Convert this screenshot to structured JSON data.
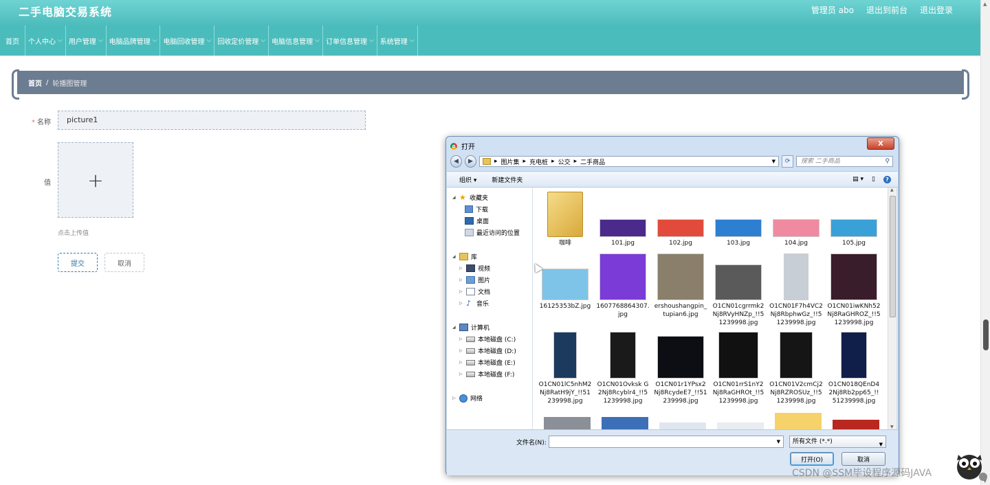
{
  "app": {
    "brand": "二手电脑交易系统",
    "admin_label": "管理员 abo",
    "back_frontend": "退出到前台",
    "logout": "退出登录"
  },
  "nav": [
    {
      "label": "首页",
      "dropdown": false
    },
    {
      "label": "个人中心",
      "dropdown": true
    },
    {
      "label": "用户管理",
      "dropdown": true
    },
    {
      "label": "电脑品牌管理",
      "dropdown": true
    },
    {
      "label": "电脑回收管理",
      "dropdown": true
    },
    {
      "label": "回收定价管理",
      "dropdown": true
    },
    {
      "label": "电脑信息管理",
      "dropdown": true
    },
    {
      "label": "订单信息管理",
      "dropdown": true
    },
    {
      "label": "系统管理",
      "dropdown": true
    }
  ],
  "breadcrumb": {
    "home": "首页",
    "sep": "/",
    "current": "轮播图管理"
  },
  "form": {
    "name_required": "*",
    "name_label": "名称",
    "name_value": "picture1",
    "value_label": "值",
    "upload_plus": "+",
    "upload_hint": "点击上传值",
    "submit": "提交",
    "cancel": "取消"
  },
  "dialog": {
    "title": "打开",
    "close": "X",
    "path": [
      "图片集",
      "充电桩",
      "公交",
      "二手商品"
    ],
    "search_placeholder": "搜索 二手商品",
    "organize": "组织 ▾",
    "new_folder": "新建文件夹",
    "tree": {
      "favorites": "收藏夹",
      "downloads": "下载",
      "desktop": "桌面",
      "recent": "最近访问的位置",
      "libraries": "库",
      "videos": "视频",
      "pictures": "图片",
      "documents": "文档",
      "music": "音乐",
      "computer": "计算机",
      "drive_c": "本地磁盘 (C:)",
      "drive_d": "本地磁盘 (D:)",
      "drive_e": "本地磁盘 (E:)",
      "drive_f": "本地磁盘 (F:)",
      "network": "网络"
    },
    "files": [
      {
        "name": "咖啡",
        "color": "#e8c35a"
      },
      {
        "name": "101.jpg",
        "color": "#4a2a8a"
      },
      {
        "name": "102.jpg",
        "color": "#e24b3b"
      },
      {
        "name": "103.jpg",
        "color": "#2d7fd1"
      },
      {
        "name": "104.jpg",
        "color": "#f08aa0"
      },
      {
        "name": "105.jpg",
        "color": "#3aa0d8"
      },
      {
        "name": "16125353bZ.jpg",
        "color": "#7ec3e8"
      },
      {
        "name": "1607768864307.jpg",
        "color": "#7a3bd6"
      },
      {
        "name": "ershoushangpin_tupian6.jpg",
        "color": "#8a7f6b"
      },
      {
        "name": "O1CN01cgrrmk2Nj8RVyHNZp_!!51239998.jpg",
        "color": "#5a5a5a"
      },
      {
        "name": "O1CN01F7h4VC2Nj8RbphwGz_!!51239998.jpg",
        "color": "#c8ced6"
      },
      {
        "name": "O1CN01iwKNh52Nj8RaGHROZ_!!51239998.jpg",
        "color": "#3a1d2a"
      },
      {
        "name": "O1CN01lC5nhM2Nj8RatH9jY_!!51239998.jpg",
        "color": "#1b3a5e"
      },
      {
        "name": "O1CN01Ovksk G2Nj8Rcyblr4_!!51239998.jpg",
        "color": "#1a1a1a"
      },
      {
        "name": "O1CN01r1YPsx2Nj8RcydeE7_!!51239998.jpg",
        "color": "#0d0d14"
      },
      {
        "name": "O1CN01rrS1nY2Nj8RaGHROt_!!51239998.jpg",
        "color": "#111"
      },
      {
        "name": "O1CN01V2cmCj2Nj8RZROSUz_!!51239998.jpg",
        "color": "#151515"
      },
      {
        "name": "O1CN018QEnD42Nj8Rb2pp65_!!51239998.jpg",
        "color": "#0f1f4a"
      }
    ],
    "filename_label": "文件名(N):",
    "filetype": "所有文件 (*.*)",
    "open_btn": "打开(O)",
    "cancel_btn": "取消"
  },
  "watermark": "CSDN @SSM毕设程序源码JAVA"
}
